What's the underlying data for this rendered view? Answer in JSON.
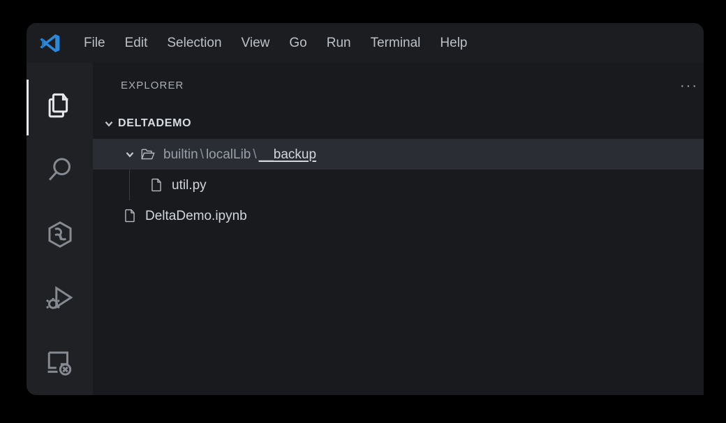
{
  "app": {
    "name": "Visual Studio Code",
    "logo_icon": "vscode-logo-icon"
  },
  "menubar": {
    "items": [
      {
        "label": "File"
      },
      {
        "label": "Edit"
      },
      {
        "label": "Selection"
      },
      {
        "label": "View"
      },
      {
        "label": "Go"
      },
      {
        "label": "Run"
      },
      {
        "label": "Terminal"
      },
      {
        "label": "Help"
      }
    ]
  },
  "activitybar": {
    "items": [
      {
        "name": "explorer",
        "icon": "files-icon",
        "active": true
      },
      {
        "name": "search",
        "icon": "search-icon",
        "active": false
      },
      {
        "name": "source-control",
        "icon": "source-control-icon",
        "active": false
      },
      {
        "name": "run-and-debug",
        "icon": "run-and-debug-icon",
        "active": false
      },
      {
        "name": "remote-explorer",
        "icon": "remote-explorer-icon",
        "active": false
      }
    ]
  },
  "sidebar": {
    "title": "EXPLORER",
    "more_actions_label": "···",
    "tree": {
      "root": {
        "label": "DELTADEMO",
        "expanded": true,
        "chevron": "chevron-down-icon"
      },
      "folder": {
        "segments": {
          "first": "builtin",
          "sep1": "\\",
          "second": "localLib",
          "sep2": "\\",
          "match": "__backup"
        },
        "full_label": "builtin\\localLib\\__backup",
        "expanded": true,
        "selected": true,
        "chevron": "chevron-down-icon",
        "icon": "folder-open-icon"
      },
      "files": [
        {
          "label": "util.py",
          "icon": "file-icon",
          "indent": 2
        },
        {
          "label": "DeltaDemo.ipynb",
          "icon": "file-icon",
          "indent": 1
        }
      ]
    }
  },
  "colors": {
    "background": "#000000",
    "window": "#1b1d21",
    "activitybar": "#1f2125",
    "sidebar": "#181a1e",
    "selected_row": "#2a2d34",
    "text": "#d2d6dd",
    "muted_text": "#a9aeb6",
    "icon": "#868a91",
    "accent": "#2c88d9"
  }
}
